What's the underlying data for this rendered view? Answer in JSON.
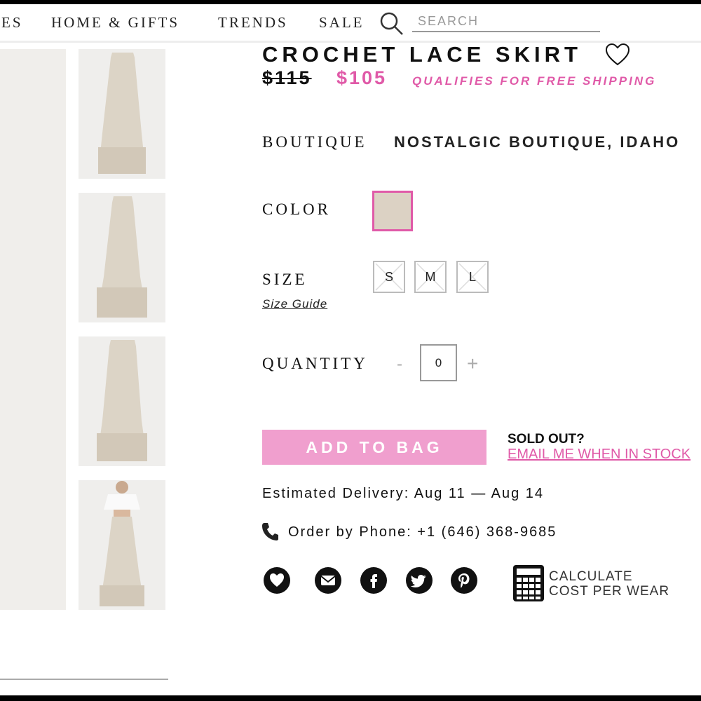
{
  "nav": {
    "items": [
      "ES",
      "HOME & GIFTS",
      "TRENDS",
      "SALE"
    ],
    "search_placeholder": "SEARCH"
  },
  "product": {
    "title": "CROCHET LACE SKIRT",
    "price_original": "$115",
    "price_sale": "$105",
    "shipping_note": "QUALIFIES FOR FREE SHIPPING",
    "boutique_label": "BOUTIQUE",
    "boutique_value": "NOSTALGIC BOUTIQUE, IDAHO",
    "color_label": "COLOR",
    "color_swatch": "#dcd2c4",
    "size_label": "SIZE",
    "sizes": [
      "S",
      "M",
      "L"
    ],
    "size_guide": "Size Guide",
    "quantity_label": "QUANTITY",
    "quantity_minus": "-",
    "quantity_plus": "+",
    "quantity_value": "0",
    "add_to_bag": "ADD TO BAG",
    "sold_out": "SOLD OUT?",
    "email_link": "EMAIL ME WHEN IN STOCK",
    "delivery": "Estimated Delivery: Aug 11 — Aug 14",
    "phone": "Order by Phone: +1 (646) 368-9685",
    "calculate_line1": "CALCULATE",
    "calculate_line2": "COST PER WEAR"
  },
  "social_icons": [
    "heart-icon",
    "email-icon",
    "facebook-icon",
    "twitter-icon",
    "pinterest-icon"
  ],
  "colors": {
    "accent_pink": "#e05aa8",
    "button_pink": "#f09fce",
    "skirt_beige": "#dcd2c4"
  }
}
